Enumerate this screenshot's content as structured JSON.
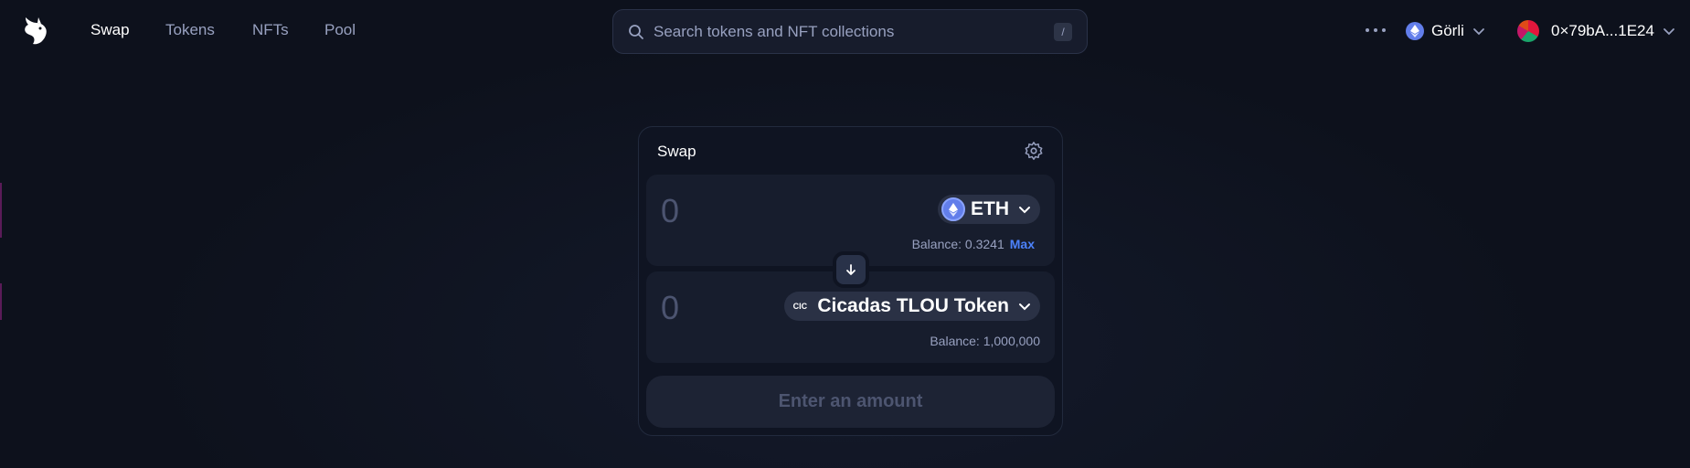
{
  "nav": {
    "logo_icon": "uniswap-unicorn-icon",
    "links": [
      {
        "label": "Swap",
        "active": true
      },
      {
        "label": "Tokens",
        "active": false
      },
      {
        "label": "NFTs",
        "active": false
      },
      {
        "label": "Pool",
        "active": false
      }
    ],
    "search": {
      "placeholder": "Search tokens and NFT collections",
      "shortcut": "/"
    },
    "network": {
      "label": "Görli",
      "icon": "ethereum-icon"
    },
    "account": {
      "label": "0×79bA...1E24"
    }
  },
  "swap": {
    "title": "Swap",
    "input": {
      "amount_placeholder": "0",
      "token_symbol": "ETH",
      "balance_label": "Balance: 0.3241",
      "max_label": "Max"
    },
    "output": {
      "amount_placeholder": "0",
      "token_symbol": "Cicadas TLOU Token",
      "token_logo_text": "CIC",
      "balance_label": "Balance: 1,000,000"
    },
    "cta_label": "Enter an amount"
  },
  "colors": {
    "background": "#0d111c",
    "accent": "#4c82fb",
    "eth": "#627eea"
  }
}
